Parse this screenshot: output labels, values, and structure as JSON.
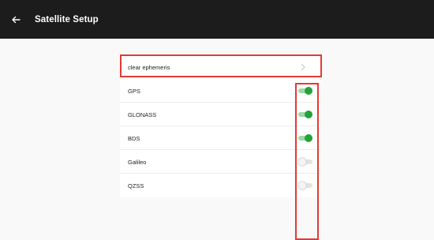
{
  "appbar": {
    "back_icon": "arrow-left-icon",
    "title": "Satellite Setup"
  },
  "rows": {
    "clear": {
      "label": "clear ephemeris",
      "icon": "chevron-right-icon"
    },
    "gps": {
      "label": "GPS",
      "enabled": true
    },
    "glonass": {
      "label": "GLONASS",
      "enabled": true
    },
    "bds": {
      "label": "BDS",
      "enabled": true
    },
    "galileo": {
      "label": "Galileo",
      "enabled": false
    },
    "qzss": {
      "label": "QZSS",
      "enabled": false
    }
  },
  "colors": {
    "appbar": "#1c1c1c",
    "toggle_on": "#22a33a",
    "highlight": "#e53935"
  }
}
